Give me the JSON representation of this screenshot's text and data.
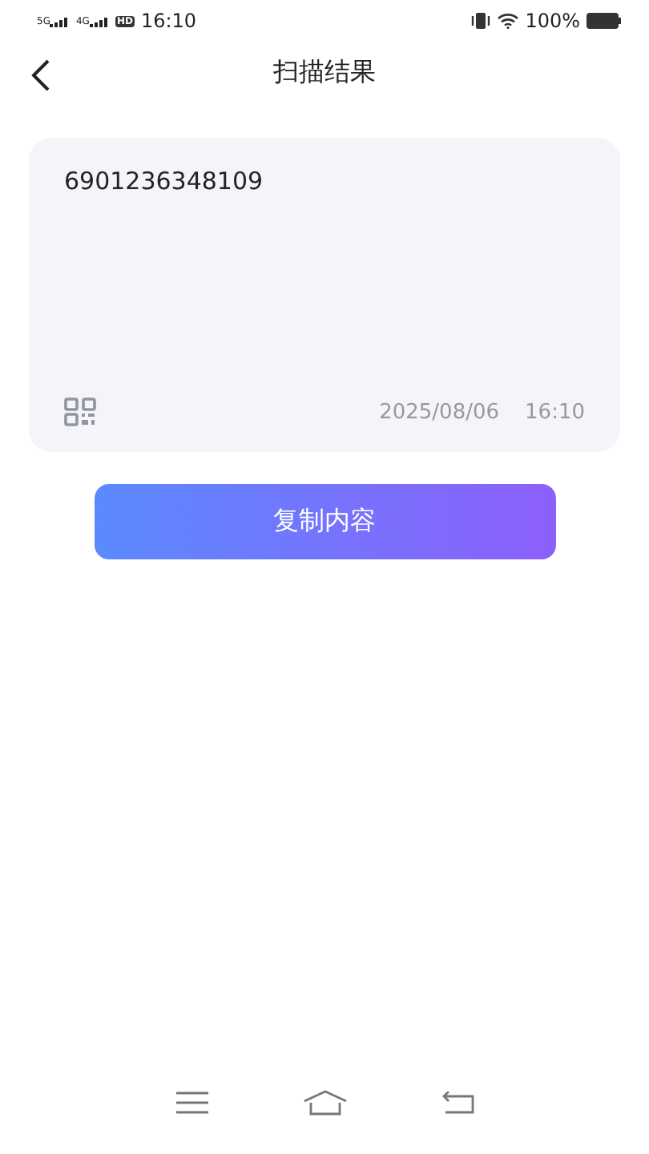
{
  "status_bar": {
    "signals": [
      {
        "label": "5G"
      },
      {
        "label": "4G"
      }
    ],
    "hd_badge": "HD",
    "time": "16:10",
    "battery": "100%"
  },
  "header": {
    "title": "扫描结果"
  },
  "result": {
    "content": "6901236348109",
    "date": "2025/08/06",
    "time": "16:10"
  },
  "copy_button": {
    "label": "复制内容"
  }
}
